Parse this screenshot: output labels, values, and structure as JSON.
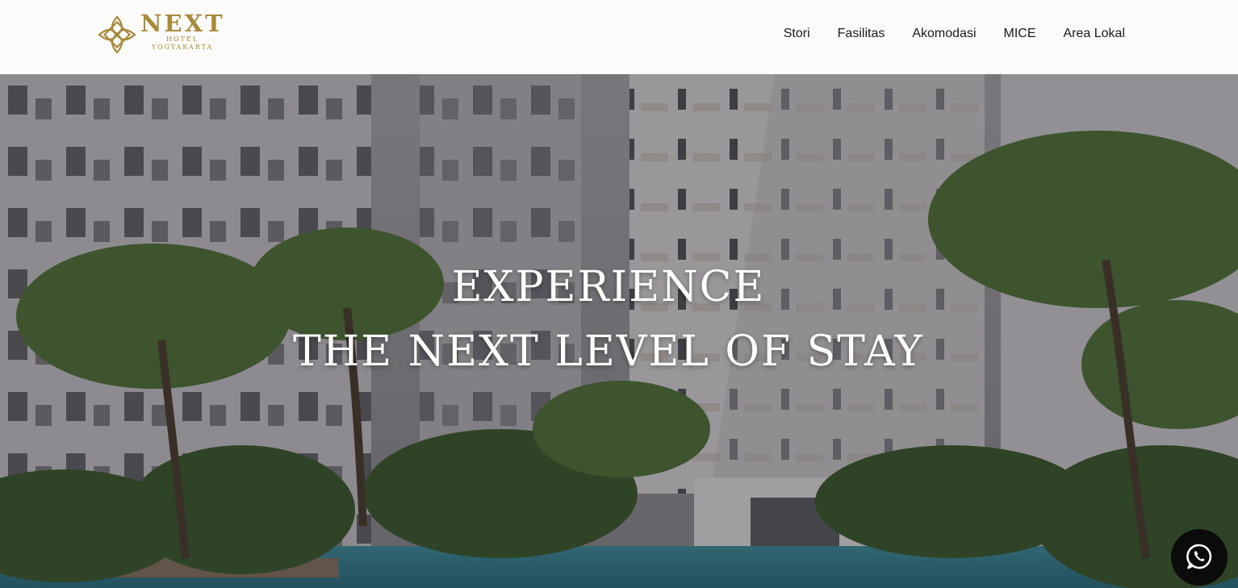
{
  "brand": {
    "name": "NEXT",
    "line1": "HOTEL",
    "line2": "YOGYAKARTA",
    "color": "#a78a3c"
  },
  "nav": {
    "items": [
      {
        "label": "Stori"
      },
      {
        "label": "Fasilitas"
      },
      {
        "label": "Akomodasi"
      },
      {
        "label": "MICE"
      },
      {
        "label": "Area Lokal"
      }
    ]
  },
  "hero": {
    "headline_line1": "EXPERIENCE",
    "headline_line2": "THE NEXT LEVEL OF STAY"
  },
  "floating": {
    "whatsapp_icon": "whatsapp-icon"
  }
}
